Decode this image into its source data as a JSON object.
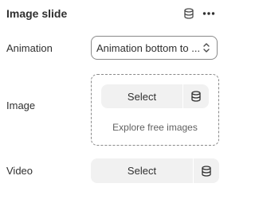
{
  "header": {
    "title": "Image slide",
    "icons": [
      "database-icon",
      "more-horizontal-icon"
    ]
  },
  "animation": {
    "label": "Animation",
    "value": "Animation bottom to ...",
    "icon": "chevron-up-down-icon"
  },
  "image": {
    "label": "Image",
    "select_label": "Select",
    "explore_label": "Explore free images",
    "icon": "database-icon"
  },
  "video": {
    "label": "Video",
    "select_label": "Select",
    "icon": "database-icon"
  },
  "colors": {
    "text": "#303030",
    "muted": "#616161",
    "button_bg": "#f1f1f1",
    "border": "#8a8a8a"
  }
}
